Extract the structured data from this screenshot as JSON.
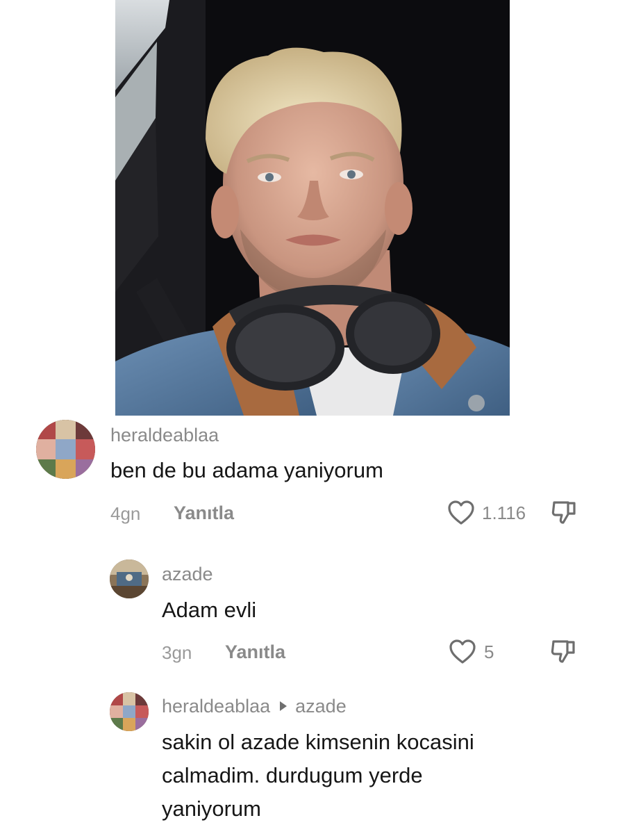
{
  "comments": [
    {
      "username": "heraldeablaa",
      "text": "ben de bu adama yaniyorum",
      "time": "4gn",
      "reply_label": "Yanıtla",
      "likes": "1.116",
      "avatar_icon": "collage-avatar-icon"
    },
    {
      "username": "azade",
      "text": "Adam evli",
      "time": "3gn",
      "reply_label": "Yanıtla",
      "likes": "5",
      "avatar_icon": "room-avatar-icon"
    },
    {
      "username": "heraldeablaa",
      "reply_to": "azade",
      "text_lines": [
        "sakin ol azade kimsenin kocasini",
        "calmadim. durdugum yerde",
        "yaniyorum"
      ],
      "avatar_icon": "collage-avatar-icon"
    }
  ],
  "icons": {
    "like": "heart-outline-icon",
    "dislike": "thumbs-down-outline-icon",
    "reply_arrow": "triangle-right-icon"
  },
  "colors": {
    "username": "#8a8a8a",
    "text": "#161616",
    "meta": "#9a9a9a"
  }
}
